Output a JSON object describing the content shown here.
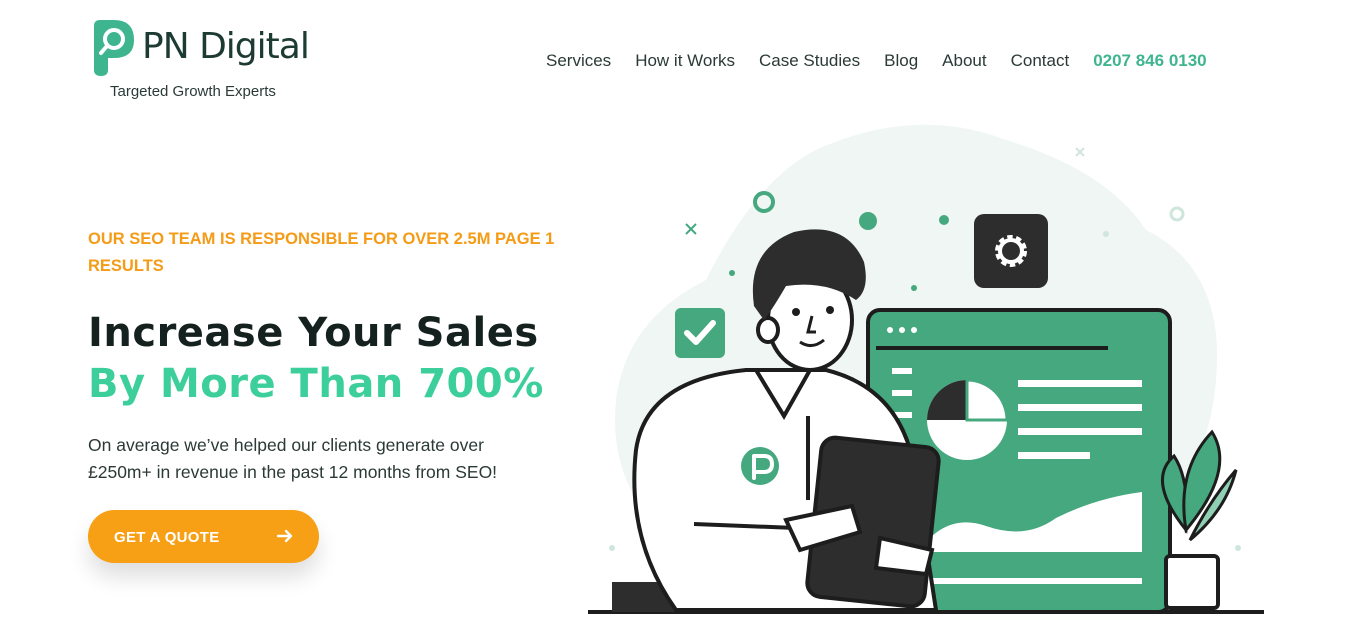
{
  "header": {
    "brand": "PN Digital",
    "tagline": "Targeted Growth Experts",
    "nav": [
      {
        "label": "Services"
      },
      {
        "label": "How it Works"
      },
      {
        "label": "Case Studies"
      },
      {
        "label": "Blog"
      },
      {
        "label": "About"
      },
      {
        "label": "Contact"
      }
    ],
    "phone": "0207 846 0130"
  },
  "hero": {
    "eyebrow": "OUR SEO TEAM IS RESPONSIBLE FOR OVER 2.5M PAGE 1 RESULTS",
    "headline_line1": "Increase Your Sales",
    "headline_line2": "By More Than 700%",
    "description": "On average we’ve helped our clients generate over £250m+ in revenue in the past 12 months from SEO!",
    "cta_label": "GET A QUOTE"
  },
  "colors": {
    "brand_green": "#3fb58f",
    "dark_green": "#1d3a33",
    "accent_orange": "#f7a016",
    "headline_green": "#3ccf9b",
    "illustration_green": "#45a87f"
  },
  "icons": {
    "cta": "arrow-right-icon",
    "settings": "gear-icon",
    "check": "check-icon"
  }
}
